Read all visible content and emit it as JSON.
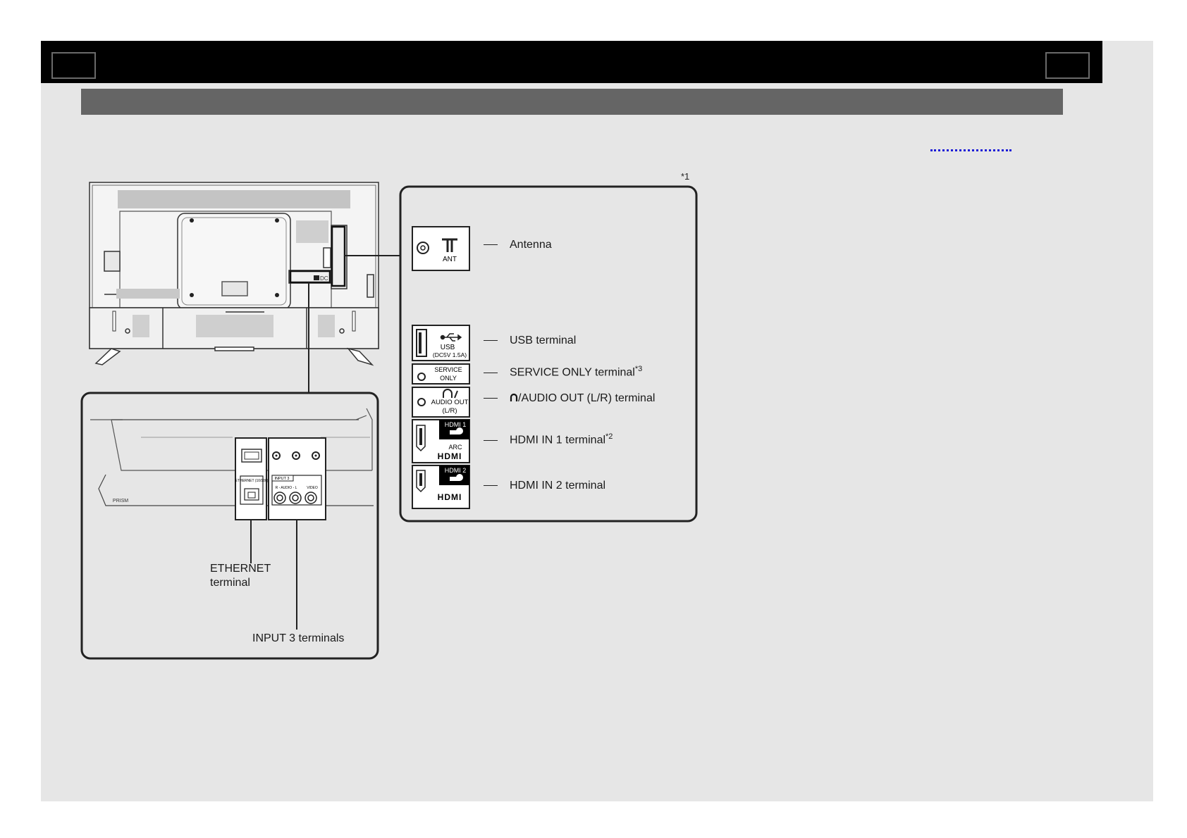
{
  "footnote_mark": "*1",
  "ports": {
    "ant": {
      "label": "ANT",
      "desc": "Antenna"
    },
    "usb": {
      "label": "USB",
      "sublabel": "(DC5V 1.5A)",
      "desc": "USB terminal"
    },
    "service": {
      "label_1": "SERVICE",
      "label_2": "ONLY",
      "desc": "SERVICE ONLY terminal",
      "note": "*3"
    },
    "audio": {
      "label_1": "AUDIO OUT",
      "label_2": "(L/R)",
      "desc": "/AUDIO OUT (L/R) terminal"
    },
    "hdmi1": {
      "label": "HDMI 1",
      "arc": "ARC",
      "logo": "HDMI",
      "desc": "HDMI IN 1 terminal",
      "note": "*2"
    },
    "hdmi2": {
      "label": "HDMI 2",
      "logo": "HDMI",
      "desc": "HDMI IN 2  terminal"
    }
  },
  "tv_panel": {
    "dc_label": "DC"
  },
  "bottom_panel": {
    "ethernet_small": "ETHERNET (10/100)",
    "input3_small": "INPUT 3",
    "audio_small": "R - AUDIO - L",
    "video_small": "VIDEO",
    "logo_small": "PRISM",
    "ethernet_line1": "ETHERNET",
    "ethernet_line2": "terminal",
    "input3_desc": "INPUT 3 terminals"
  },
  "icons": {
    "antenna": "antenna-icon",
    "usb": "usb-trident-icon",
    "headphone": "headphone-icon",
    "hdmi": "hdmi-connector-icon"
  }
}
